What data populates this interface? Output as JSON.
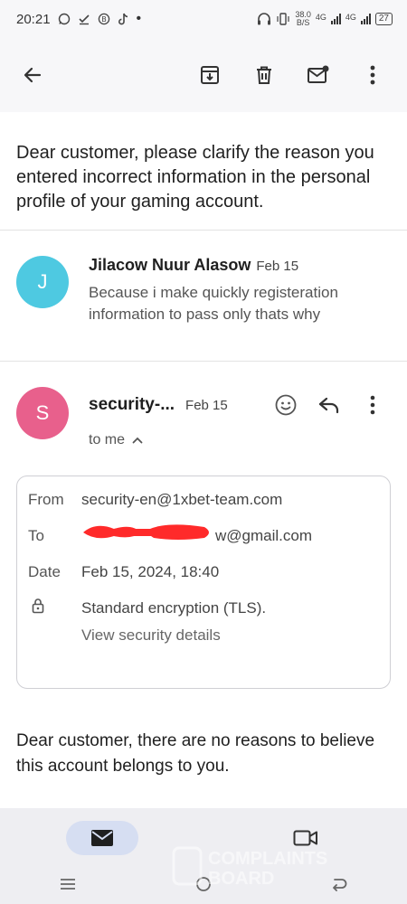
{
  "status_bar": {
    "time": "20:21",
    "network_speed_value": "38.0",
    "network_speed_unit": "B/S",
    "signal_1_label": "4G",
    "signal_2_label": "4G",
    "battery": "27"
  },
  "app_bar": {
    "icons": [
      "back-arrow-icon",
      "archive-icon",
      "delete-icon",
      "mark-unread-icon",
      "more-vert-icon"
    ]
  },
  "email": {
    "subject": "Dear customer, please clarify the reason you entered incorrect information in the personal profile of your gaming account.",
    "reply": {
      "avatar_letter": "J",
      "avatar_color": "#4ec9e1",
      "sender": "Jilacow Nuur Alasow",
      "date": "Feb 15",
      "snippet": "Because i make quickly registeration information to pass only thats why"
    },
    "message": {
      "avatar_letter": "S",
      "avatar_color": "#e8608c",
      "sender": "security-...",
      "date": "Feb 15",
      "to_line": "to me",
      "details": {
        "from_label": "From",
        "from_value": "security-en@1xbet-team.com",
        "to_label": "To",
        "to_value": "w@gmail.com",
        "date_label": "Date",
        "date_value": "Feb 15, 2024, 18:40",
        "encryption": "Standard encryption (TLS).",
        "security_link": "View security details"
      },
      "body": "Dear customer, there are no reasons to believe this account belongs to you."
    }
  },
  "watermark": {
    "line1": "COMPLAINTS",
    "line2": "BOARD"
  },
  "colors": {
    "accent_pill": "#d6def2",
    "redaction": "#ff2a2a"
  }
}
